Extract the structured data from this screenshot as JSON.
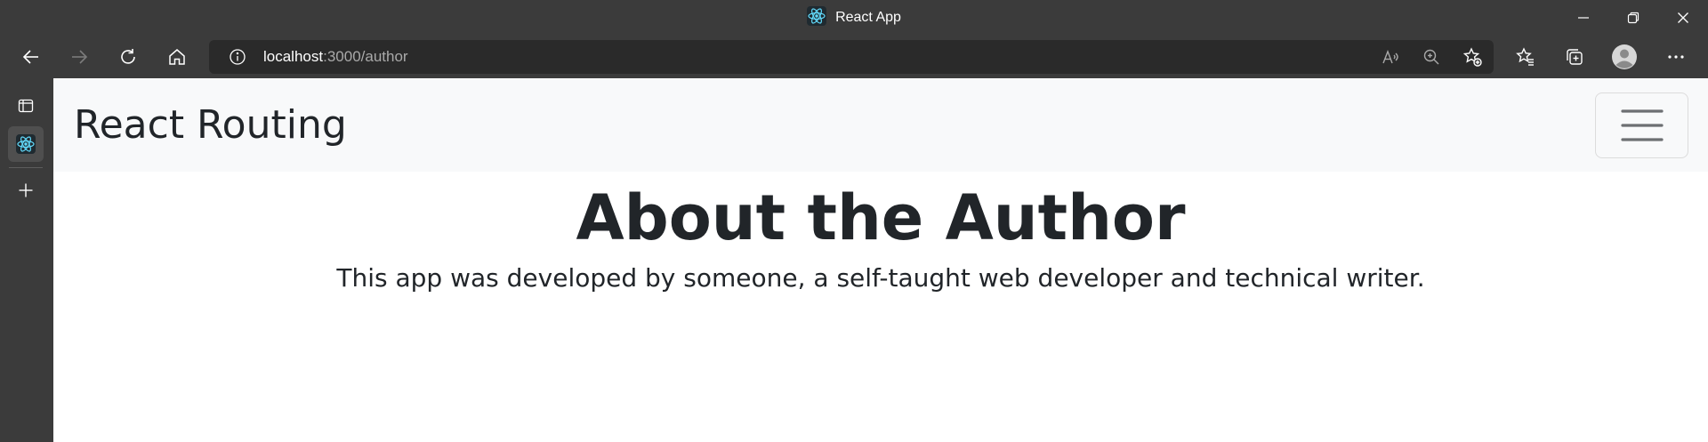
{
  "window": {
    "title": "React App",
    "icons": {
      "app": "react-logo-icon",
      "minimize": "minimize-icon",
      "restore": "restore-icon",
      "close": "close-icon"
    }
  },
  "toolbar": {
    "address": {
      "host": "localhost",
      "path": ":3000/author"
    },
    "icons": [
      "back-icon",
      "forward-icon",
      "refresh-icon",
      "home-icon",
      "site-info-icon",
      "read-aloud-icon",
      "zoom-icon",
      "add-favorite-icon",
      "favorites-icon",
      "collections-icon",
      "profile-icon",
      "more-icon"
    ]
  },
  "sidebar": {
    "icons": [
      "tab-actions-icon",
      "react-logo-icon",
      "new-tab-icon"
    ]
  },
  "page": {
    "navbar": {
      "brand": "React Routing"
    },
    "heading": "About the Author",
    "lead": "This app was developed by someone, a self-taught web developer and technical writer."
  },
  "colors": {
    "chrome": "#3b3b3b",
    "address_bar": "#2a2a2a",
    "navbar": "#f8f9fa",
    "text": "#212529",
    "react": "#61dafb"
  }
}
